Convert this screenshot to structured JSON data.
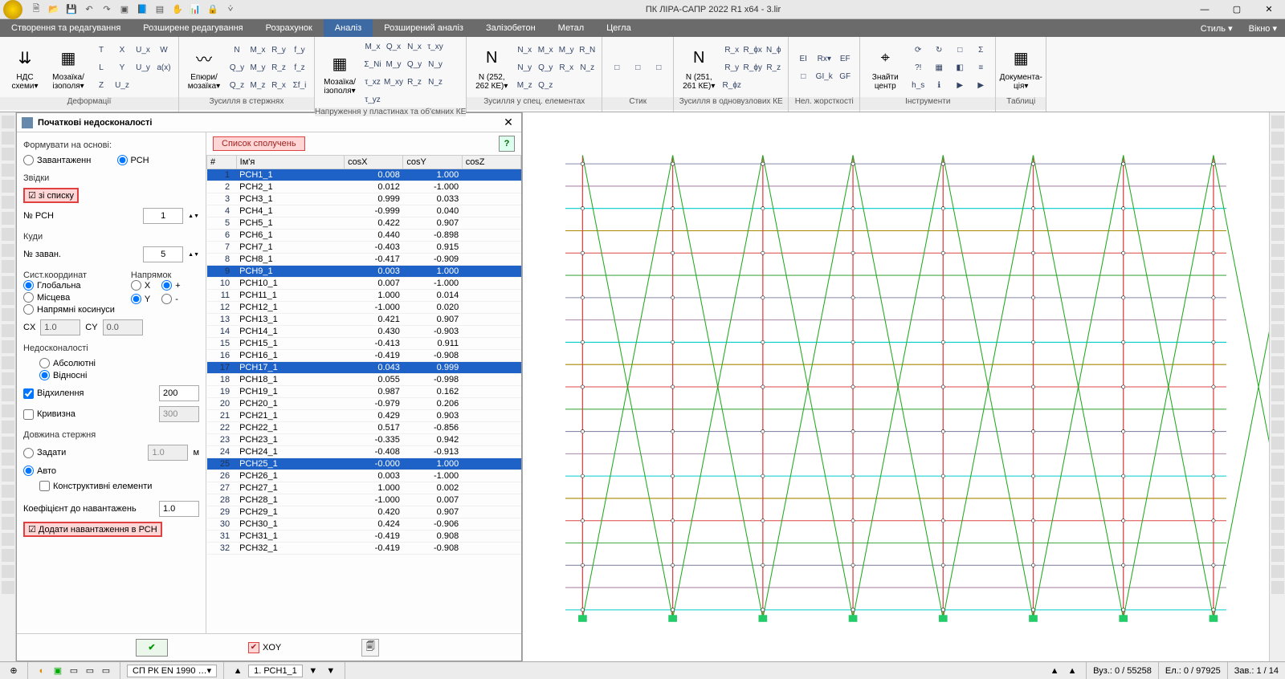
{
  "app": {
    "title": "ПК ЛІРА-САПР  2022 R1 x64 - 3.lir"
  },
  "menu": {
    "items": [
      "Створення та редагування",
      "Розширене редагування",
      "Розрахунок",
      "Аналіз",
      "Розширений аналіз",
      "Залізобетон",
      "Метал",
      "Цегла"
    ],
    "active_index": 3,
    "right": [
      "Стиль",
      "Вікно"
    ]
  },
  "ribbon": {
    "groups": [
      {
        "caption": "Деформації",
        "big": [
          {
            "icon": "⇊",
            "label": "НДС схеми▾"
          }
        ],
        "sub": [
          {
            "icon": "▦",
            "label": "Мозаїка/ ізополя▾"
          }
        ],
        "grid": [
          "T",
          "X",
          "U_x",
          "W",
          "L",
          "Y",
          "U_y",
          "a(x)",
          "Z",
          "U_z"
        ]
      },
      {
        "caption": "Зусилля в стержнях",
        "big": [
          {
            "icon": "〰",
            "label": "Епюри/ мозаїка▾"
          }
        ],
        "grid": [
          "N",
          "M_x",
          "R_y",
          "f_y",
          "Q_y",
          "M_y",
          "R_z",
          "f_z",
          "Q_z",
          "M_z",
          "R_x",
          "Σf_i"
        ]
      },
      {
        "caption": "Напруження у пластинах та об'ємних КЕ",
        "big": [
          {
            "icon": "▦",
            "label": "Мозаїка/ ізополя▾"
          }
        ],
        "grid": [
          "M_x",
          "Q_x",
          "N_x",
          "τ_xy",
          "Σ_Ni",
          "M_y",
          "Q_y",
          "N_y",
          "τ_xz",
          "M_xy",
          "R_z",
          "N_z",
          "τ_yz"
        ]
      },
      {
        "caption": "Зусилля у спец. елементах",
        "big": [
          {
            "icon": "N",
            "label": "N (252, 262 КЕ)▾"
          }
        ],
        "grid": [
          "N_x",
          "M_x",
          "M_y",
          "R_N",
          "N_y",
          "Q_y",
          "R_x",
          "N_z",
          "M_z",
          "Q_z"
        ]
      },
      {
        "caption": "Стик",
        "grid": [
          "□",
          "□",
          "□"
        ]
      },
      {
        "caption": "Зусилля в одновузлових КЕ",
        "big": [
          {
            "icon": "N",
            "label": "N (251, 261 КЕ)▾"
          }
        ],
        "grid": [
          "R_x",
          "R_ϕx",
          "N_ϕ",
          "R_y",
          "R_ϕy",
          "R_z",
          "R_ϕz"
        ]
      },
      {
        "caption": "Нел. жорсткості",
        "grid": [
          "EI",
          "Rx▾",
          "EF",
          "□",
          "GI_k",
          "GF"
        ]
      },
      {
        "caption": "Інструменти",
        "big": [
          {
            "icon": "⌖",
            "label": "Знайти центр"
          }
        ],
        "grid": [
          "⟳",
          "↻",
          "□",
          "Σ",
          "?!",
          "▦",
          "◧",
          "≡",
          "h_s",
          "ℹ",
          "▶",
          "▶"
        ]
      },
      {
        "caption": "Таблиці",
        "big": [
          {
            "icon": "▦",
            "label": "Документа- ція▾"
          }
        ]
      }
    ]
  },
  "dialog": {
    "title": "Початкові недосконалості",
    "form_basis_label": "Формувати на основі:",
    "basis_options": [
      "Завантаженн",
      "РСН"
    ],
    "basis_selected": 1,
    "from_label": "Звідки",
    "from_list_chk": "зі списку",
    "rsn_no_label": "№ РСН",
    "rsn_no_value": "1",
    "to_label": "Куди",
    "zavan_no_label": "№ заван.",
    "zavan_no_value": "5",
    "coord_label": "Сист.координат",
    "coord_options": [
      "Глобальна",
      "Місцева",
      "Напрямні косинуси"
    ],
    "coord_selected": 0,
    "direction_label": "Напрямок",
    "dir_x": "X",
    "dir_y": "Y",
    "dir_plus": "+",
    "dir_minus": "-",
    "cx_label": "CX",
    "cx_value": "1.0",
    "cy_label": "CY",
    "cy_value": "0.0",
    "imperf_label": "Недосконалості",
    "imperf_options": [
      "Абсолютні",
      "Відносні"
    ],
    "imperf_selected": 1,
    "dev_chk": "Відхилення",
    "dev_val": "200",
    "curv_chk": "Кривизна",
    "curv_val": "300",
    "barlen_label": "Довжина стержня",
    "barlen_options": [
      "Задати",
      "Авто"
    ],
    "barlen_selected": 1,
    "barlen_val": "1.0",
    "barlen_unit": "м",
    "constr_chk": "Конструктивні елементи",
    "coef_label": "Коефіцієнт до навантажень",
    "coef_val": "1.0",
    "add_rsn_chk": "Додати навантаження в РСН",
    "list_btn": "Список сполучень",
    "xoy_label": "XOY",
    "headers": [
      "#",
      "Ім'я",
      "cosX",
      "cosY",
      "cosZ"
    ],
    "rows": [
      {
        "i": 1,
        "name": "РСН1_1",
        "cx": "0.008",
        "cy": "1.000",
        "sel": true
      },
      {
        "i": 2,
        "name": "РСН2_1",
        "cx": "0.012",
        "cy": "-1.000"
      },
      {
        "i": 3,
        "name": "РСН3_1",
        "cx": "0.999",
        "cy": "0.033"
      },
      {
        "i": 4,
        "name": "РСН4_1",
        "cx": "-0.999",
        "cy": "0.040"
      },
      {
        "i": 5,
        "name": "РСН5_1",
        "cx": "0.422",
        "cy": "0.907"
      },
      {
        "i": 6,
        "name": "РСН6_1",
        "cx": "0.440",
        "cy": "-0.898"
      },
      {
        "i": 7,
        "name": "РСН7_1",
        "cx": "-0.403",
        "cy": "0.915"
      },
      {
        "i": 8,
        "name": "РСН8_1",
        "cx": "-0.417",
        "cy": "-0.909"
      },
      {
        "i": 9,
        "name": "РСН9_1",
        "cx": "0.003",
        "cy": "1.000",
        "sel": true
      },
      {
        "i": 10,
        "name": "РСН10_1",
        "cx": "0.007",
        "cy": "-1.000"
      },
      {
        "i": 11,
        "name": "РСН11_1",
        "cx": "1.000",
        "cy": "0.014"
      },
      {
        "i": 12,
        "name": "РСН12_1",
        "cx": "-1.000",
        "cy": "0.020"
      },
      {
        "i": 13,
        "name": "РСН13_1",
        "cx": "0.421",
        "cy": "0.907"
      },
      {
        "i": 14,
        "name": "РСН14_1",
        "cx": "0.430",
        "cy": "-0.903"
      },
      {
        "i": 15,
        "name": "РСН15_1",
        "cx": "-0.413",
        "cy": "0.911"
      },
      {
        "i": 16,
        "name": "РСН16_1",
        "cx": "-0.419",
        "cy": "-0.908"
      },
      {
        "i": 17,
        "name": "РСН17_1",
        "cx": "0.043",
        "cy": "0.999",
        "sel": true
      },
      {
        "i": 18,
        "name": "РСН18_1",
        "cx": "0.055",
        "cy": "-0.998"
      },
      {
        "i": 19,
        "name": "РСН19_1",
        "cx": "0.987",
        "cy": "0.162"
      },
      {
        "i": 20,
        "name": "РСН20_1",
        "cx": "-0.979",
        "cy": "0.206"
      },
      {
        "i": 21,
        "name": "РСН21_1",
        "cx": "0.429",
        "cy": "0.903"
      },
      {
        "i": 22,
        "name": "РСН22_1",
        "cx": "0.517",
        "cy": "-0.856"
      },
      {
        "i": 23,
        "name": "РСН23_1",
        "cx": "-0.335",
        "cy": "0.942"
      },
      {
        "i": 24,
        "name": "РСН24_1",
        "cx": "-0.408",
        "cy": "-0.913"
      },
      {
        "i": 25,
        "name": "РСН25_1",
        "cx": "-0.000",
        "cy": "1.000",
        "sel": true
      },
      {
        "i": 26,
        "name": "РСН26_1",
        "cx": "0.003",
        "cy": "-1.000"
      },
      {
        "i": 27,
        "name": "РСН27_1",
        "cx": "1.000",
        "cy": "0.002"
      },
      {
        "i": 28,
        "name": "РСН28_1",
        "cx": "-1.000",
        "cy": "0.007"
      },
      {
        "i": 29,
        "name": "РСН29_1",
        "cx": "0.420",
        "cy": "0.907"
      },
      {
        "i": 30,
        "name": "РСН30_1",
        "cx": "0.424",
        "cy": "-0.906"
      },
      {
        "i": 31,
        "name": "РСН31_1",
        "cx": "-0.419",
        "cy": "0.908"
      },
      {
        "i": 32,
        "name": "РСН32_1",
        "cx": "-0.419",
        "cy": "-0.908"
      }
    ]
  },
  "status": {
    "code_dd": "СП РК EN 1990 …",
    "load_dd": "1.  РСН1_1",
    "nodes": "Вуз.: 0 / 55258",
    "elems": "Ел.: 0 / 97925",
    "tasks": "Зав.: 1 / 14"
  }
}
